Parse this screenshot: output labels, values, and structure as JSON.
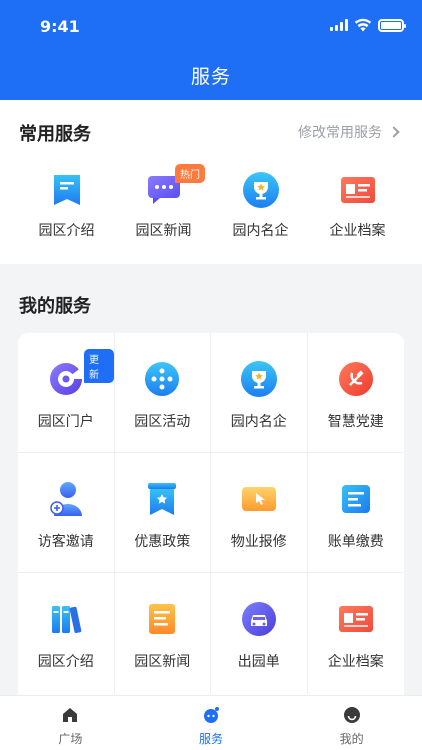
{
  "status": {
    "time": "9:41"
  },
  "header": {
    "title": "服务"
  },
  "common": {
    "title": "常用服务",
    "modify_label": "修改常用服务",
    "items": [
      {
        "label": "园区介绍",
        "icon": "bookmark-doc-icon"
      },
      {
        "label": "园区新闻",
        "icon": "chat-bubble-icon",
        "badge": "热门"
      },
      {
        "label": "园内名企",
        "icon": "trophy-icon"
      },
      {
        "label": "企业档案",
        "icon": "id-card-icon"
      }
    ]
  },
  "mine": {
    "title": "我的服务",
    "items": [
      {
        "label": "园区门户",
        "icon": "portal-icon",
        "badge": "更新"
      },
      {
        "label": "园区活动",
        "icon": "activity-icon"
      },
      {
        "label": "园内名企",
        "icon": "trophy-icon"
      },
      {
        "label": "智慧党建",
        "icon": "party-emblem-icon"
      },
      {
        "label": "访客邀请",
        "icon": "visitor-icon"
      },
      {
        "label": "优惠政策",
        "icon": "star-bookmark-icon"
      },
      {
        "label": "物业报修",
        "icon": "repair-icon"
      },
      {
        "label": "账单缴费",
        "icon": "bill-icon"
      },
      {
        "label": "园区介绍",
        "icon": "books-icon"
      },
      {
        "label": "园区新闻",
        "icon": "news-doc-icon"
      },
      {
        "label": "出园单",
        "icon": "car-icon"
      },
      {
        "label": "企业档案",
        "icon": "id-card-icon"
      }
    ]
  },
  "tabbar": {
    "tabs": [
      {
        "label": "广场",
        "icon": "home-icon"
      },
      {
        "label": "服务",
        "icon": "service-icon",
        "active": true
      },
      {
        "label": "我的",
        "icon": "profile-icon"
      }
    ]
  },
  "colors": {
    "brand": "#1e6ff5",
    "hot_badge": "#ff7a3c"
  }
}
